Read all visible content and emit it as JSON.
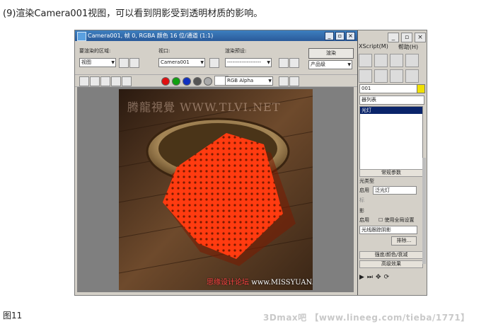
{
  "article": {
    "step_caption": "(9)渲染Camera001视图，可以看到阴影受到透明材质的影响。",
    "figure_label": "图11",
    "footer_credit": "3Dmax吧 【www.lineeg.com/tieba/1771】"
  },
  "render_window": {
    "title": "Camera001, 帧 0, RGBA 颜色 16 位/通道 (1:1)",
    "area_label": "要渲染的区域:",
    "area_value": "视图",
    "viewport_label": "视口:",
    "viewport_value": "Camera001",
    "preset_label": "渲染预设:",
    "preset_value": "-------------------",
    "render_button": "渲染",
    "product_value": "产品级",
    "channel_value": "RGB Alpha"
  },
  "render_image": {
    "watermark_top": "腾龍視覺 WWW.TLVI.NET",
    "watermark_bottom_cn": "思缘设计论坛",
    "watermark_bottom_url": "www.MISSYUAN.COM"
  },
  "command_panel": {
    "menu_script": "XScript(M)",
    "menu_help": "帮助(H)",
    "object_name": "001",
    "object_list": "器列表",
    "list_selected": "光灯",
    "rollout_general": "常规参数",
    "light_type_label": "光类型",
    "enable_label": "启用",
    "light_type_value": "泛光灯",
    "target_label": "标",
    "shadow_label": "影",
    "shadow_enable": "启用",
    "use_global": "使用全局设置",
    "shadow_type_value": "光线跟踪阴影",
    "exclude_button": "排除...",
    "rollout_intensity": "强度/颜色/衰减",
    "rollout_advanced": "高级效果"
  },
  "colors": {
    "title_bar": "#2a5a9a",
    "panel_bg": "#d4d0c8",
    "cloth_red": "#ff3b10",
    "floor_brown": "#5b3a22"
  }
}
